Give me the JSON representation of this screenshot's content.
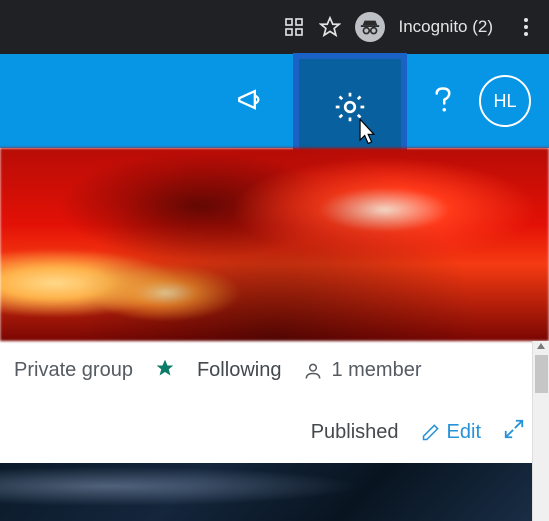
{
  "browser": {
    "incognito_label": "Incognito (2)"
  },
  "header": {
    "avatar_initials": "HL"
  },
  "group": {
    "privacy_label": "Private group",
    "following_label": "Following",
    "member_label": "1 member"
  },
  "actions": {
    "status_label": "Published",
    "edit_label": "Edit"
  }
}
